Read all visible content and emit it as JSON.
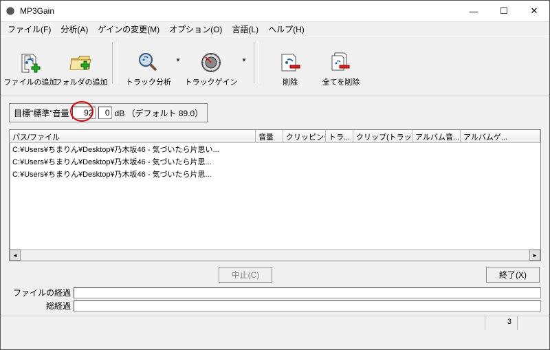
{
  "title": "MP3Gain",
  "menus": {
    "file": "ファイル(F)",
    "analysis": "分析(A)",
    "gain": "ゲインの変更(M)",
    "options": "オプション(O)",
    "language": "言語(L)",
    "help": "ヘルプ(H)"
  },
  "toolbar": {
    "add_file": "ファイルの追加",
    "add_folder": "フォルダの追加",
    "track_analysis": "トラック分析",
    "track_gain": "トラックゲイン",
    "delete": "削除",
    "delete_all": "全てを削除"
  },
  "target": {
    "label_pre": "目標\"標準\"音量",
    "value": "92",
    "decimal": "0",
    "label_post": "dB （デフォルト 89.0）"
  },
  "columns": {
    "path": "パス/ファイル",
    "volume": "音量",
    "clipping": "クリッピング",
    "track": "トラ...",
    "clip_track": "クリップ(トラッ...",
    "album_vol": "アルバム音...",
    "album_gain": "アルバムゲ..."
  },
  "files": [
    "C:¥Users¥ちまりん¥Desktop¥乃木坂46 - 気づいたら片思い...",
    "C:¥Users¥ちまりん¥Desktop¥乃木坂46 - 気づいたら片思...",
    "C:¥Users¥ちまりん¥Desktop¥乃木坂46 - 気づいたら片思..."
  ],
  "buttons": {
    "cancel": "中止(C)",
    "exit": "終了(X)"
  },
  "progress": {
    "file_label": "ファイルの経過",
    "total_label": "総経過"
  },
  "status": {
    "count": "3"
  }
}
